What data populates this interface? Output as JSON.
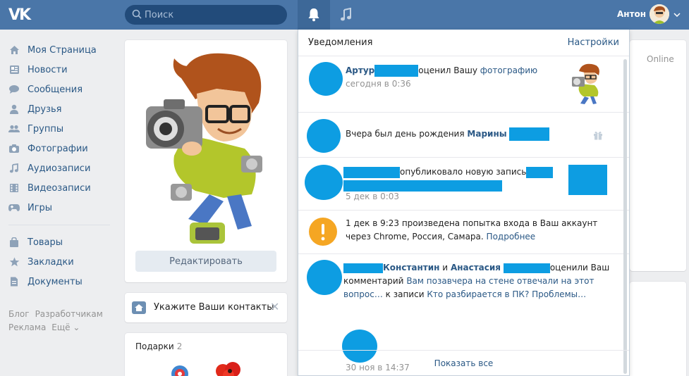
{
  "header": {
    "logo_text": "VK",
    "search_placeholder": "Поиск",
    "user_name": "Антон"
  },
  "sidebar": {
    "items": [
      {
        "label": "Моя Страница",
        "icon": "home-icon"
      },
      {
        "label": "Новости",
        "icon": "news-icon"
      },
      {
        "label": "Сообщения",
        "icon": "messages-icon"
      },
      {
        "label": "Друзья",
        "icon": "friend-icon"
      },
      {
        "label": "Группы",
        "icon": "groups-icon"
      },
      {
        "label": "Фотографии",
        "icon": "camera-icon"
      },
      {
        "label": "Аудиозаписи",
        "icon": "music-icon"
      },
      {
        "label": "Видеозаписи",
        "icon": "video-icon"
      },
      {
        "label": "Игры",
        "icon": "gamepad-icon"
      }
    ],
    "items2": [
      {
        "label": "Товары",
        "icon": "bag-icon"
      },
      {
        "label": "Закладки",
        "icon": "star-icon"
      },
      {
        "label": "Документы",
        "icon": "document-icon"
      }
    ],
    "footer": {
      "blog": "Блог",
      "developers": "Разработчикам",
      "ads": "Реклама",
      "more": "Ещё ⌄"
    }
  },
  "profile": {
    "edit_button": "Редактировать",
    "contacts_text": "Укажите Ваши контакты",
    "gifts_title": "Подарки",
    "gifts_count": "2"
  },
  "right_column": {
    "online": "Online"
  },
  "notifications": {
    "title": "Уведомления",
    "settings": "Настройки",
    "show_all": "Показать все",
    "n1": {
      "name": "Артур",
      "action": "оценил Вашу",
      "object": "фотографию",
      "time": "сегодня в 0:36"
    },
    "n2": {
      "text": "Вчера был день рождения",
      "name": "Марины"
    },
    "n3": {
      "action": "опубликовало новую запись",
      "time": "5 дек в 0:03"
    },
    "n4": {
      "text": "1 дек в 9:23 произведена попытка входа в Ваш аккаунт через Chrome, Россия, Самара.",
      "link": "Подробнее"
    },
    "n5": {
      "name1": "Константин",
      "and": "и",
      "name2": "Анастасия",
      "action": "оценили Ваш",
      "comment_word": "комментарий",
      "comment_text": "Вам позавчера на стене отвечали на этот вопрос…",
      "to_post": "к записи",
      "post_title": "Кто разбирается в ПК? Проблемы…",
      "time": "30 ноя в 14:37"
    }
  }
}
